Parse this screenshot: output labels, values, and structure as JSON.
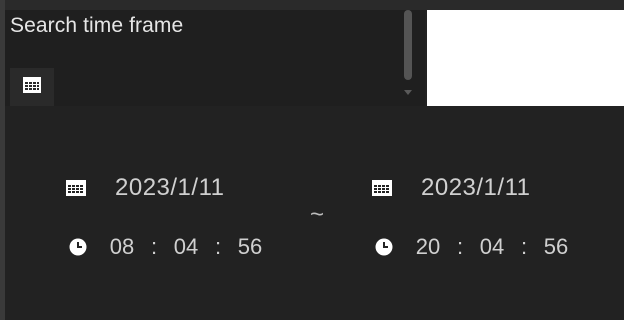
{
  "search": {
    "title": "Search time frame"
  },
  "range": {
    "start": {
      "date": "2023/1/11",
      "hour": "08",
      "minute": "04",
      "second": "56"
    },
    "separator": "~",
    "end": {
      "date": "2023/1/11",
      "hour": "20",
      "minute": "04",
      "second": "56"
    },
    "time_separator": ":"
  },
  "icons": {
    "calendar": "calendar-icon",
    "clock": "clock-icon"
  },
  "colors": {
    "background": "#222222",
    "text": "#d0d0d0",
    "panel": "#1f1f1f"
  }
}
